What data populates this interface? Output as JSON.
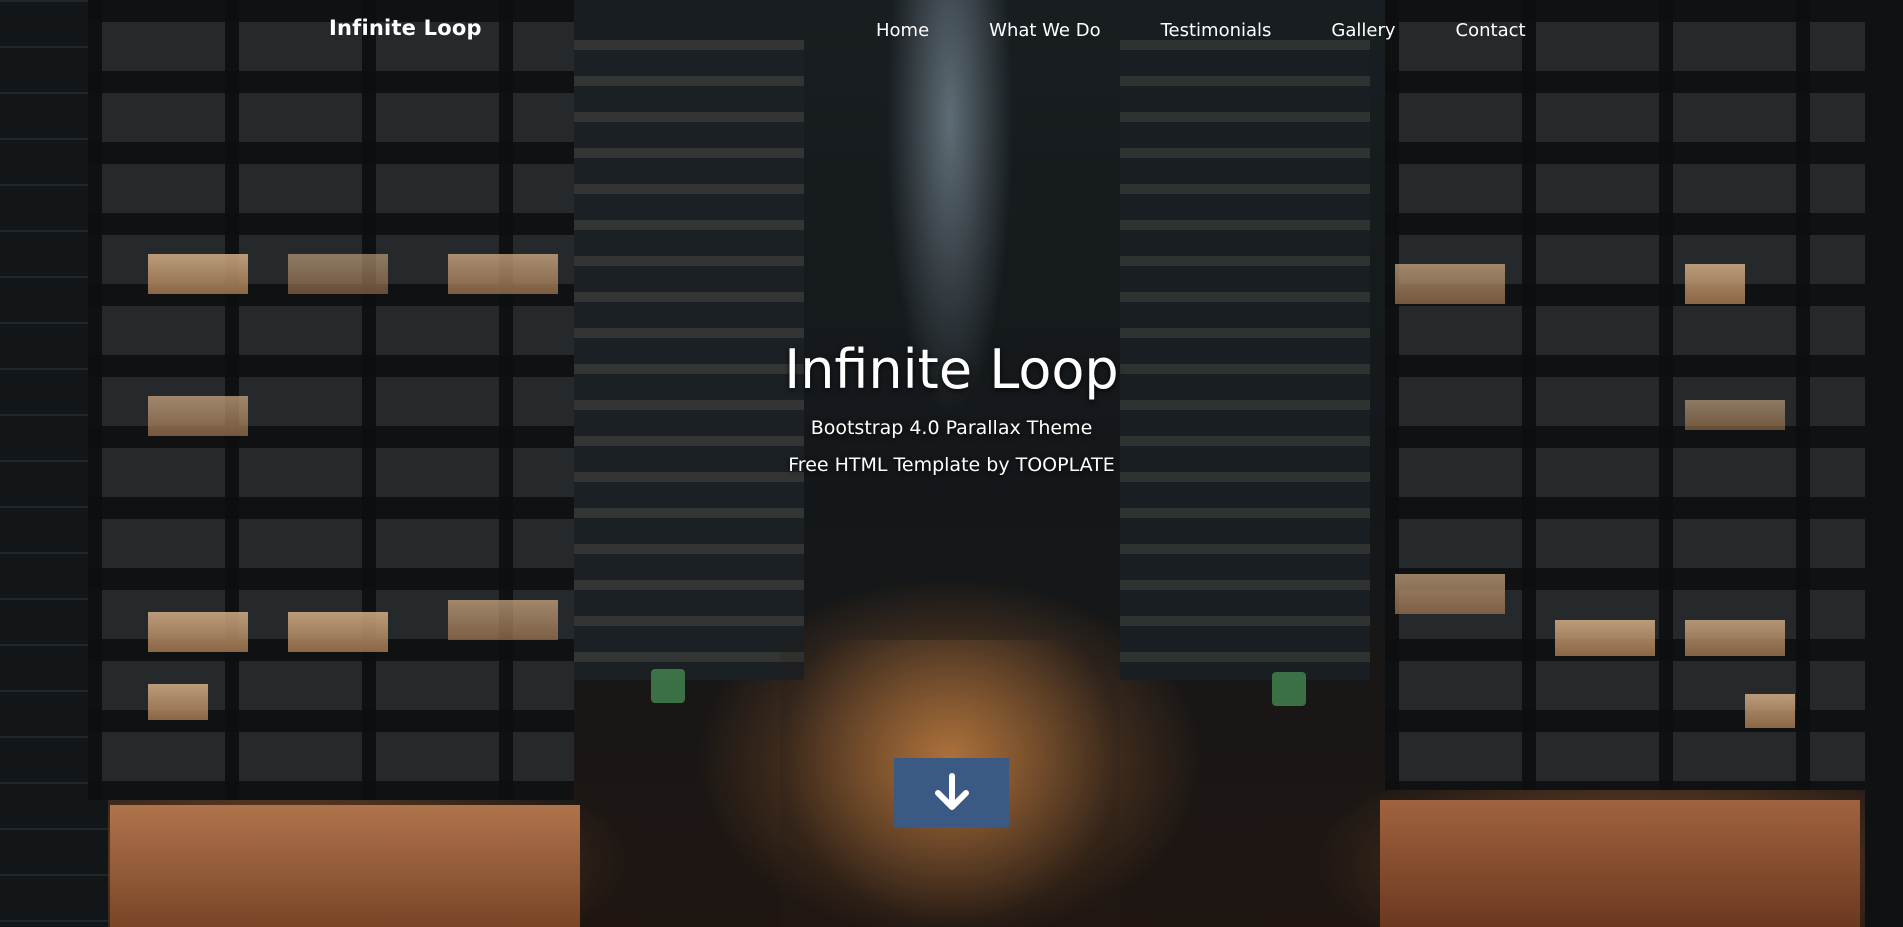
{
  "nav": {
    "brand": "Infinite Loop",
    "items": [
      {
        "label": "Home"
      },
      {
        "label": "What We Do"
      },
      {
        "label": "Testimonials"
      },
      {
        "label": "Gallery"
      },
      {
        "label": "Contact"
      }
    ]
  },
  "hero": {
    "title": "Infinite Loop",
    "subtitle": "Bootstrap 4.0 Parallax Theme",
    "tagline": "Free HTML Template by TOOPLATE",
    "scroll_icon": "arrow-down-icon"
  },
  "colors": {
    "accent": "#3a5a83",
    "text": "#ffffff"
  }
}
